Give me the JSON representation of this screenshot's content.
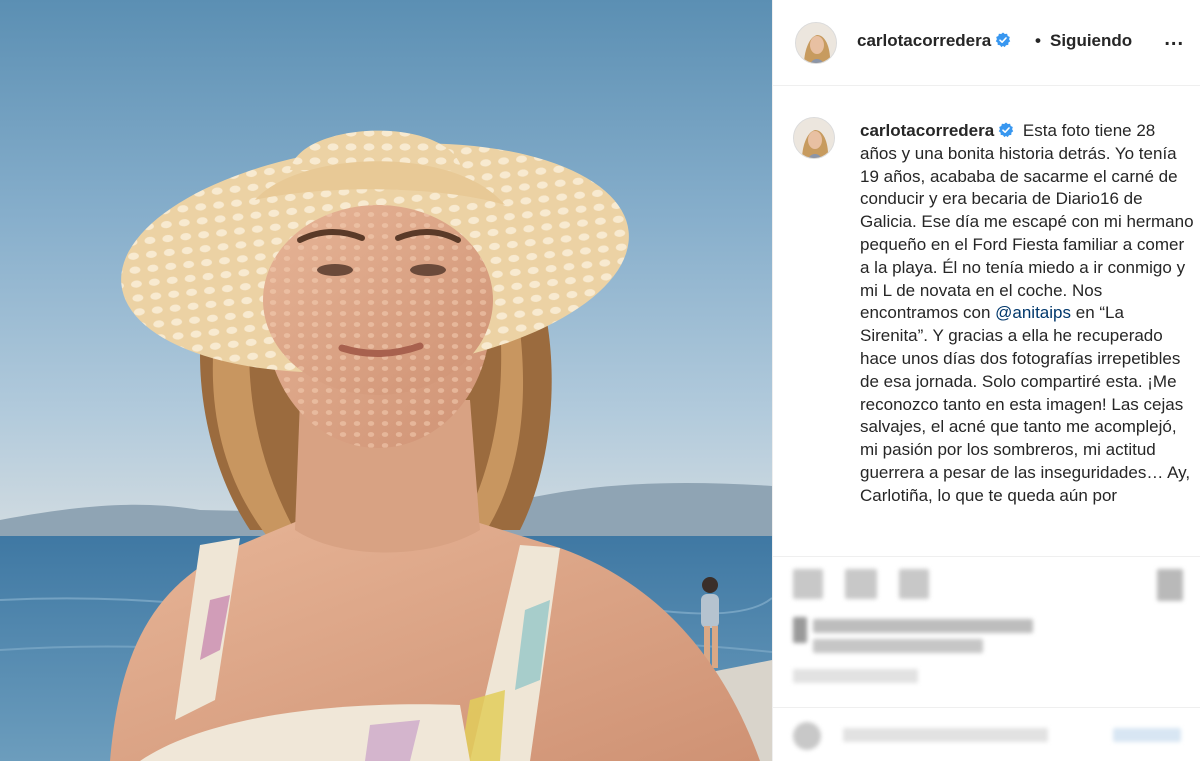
{
  "header": {
    "username": "carlotacorredera",
    "separator": "•",
    "follow_status": "Siguiendo",
    "more_label": "..."
  },
  "caption": {
    "username": "carlotacorredera",
    "text_before_mention": "Esta foto tiene 28 años y una bonita historia detrás. Yo tenía 19 años, acababa de sacarme el carné de conducir y era becaria de Diario16 de Galicia. Ese día me escapé con mi hermano pequeño en el Ford Fiesta familiar a comer a la playa. Él no tenía miedo a ir conmigo y mi L de novata en el coche. Nos encontramos con",
    "mention": "@anitaips",
    "text_after_mention": "en “La Sirenita”. Y gracias a ella he recuperado hace unos días dos fotografías irrepetibles de esa jornada. Solo compartiré esta. ¡Me reconozco tanto en esta imagen! Las cejas salvajes, el acné que tanto me acomplejó, mi pasión por los sombreros, mi actitud guerrera a pesar de las inseguridades… Ay, Carlotiña, lo que te queda aún por"
  },
  "icons": {
    "verified": "verified-badge-icon",
    "like": "heart-icon",
    "comment": "comment-icon",
    "share": "share-icon",
    "save": "bookmark-icon",
    "emoji": "emoji-icon"
  },
  "colors": {
    "verified_blue": "#3897f0",
    "mention_blue": "#00376b",
    "border": "#efefef"
  }
}
